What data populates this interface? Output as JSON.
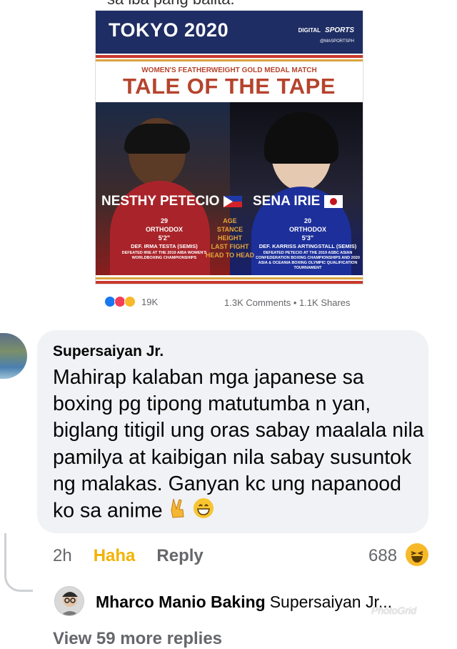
{
  "top_cut_text": "sa iba pang balita.",
  "graphic": {
    "event": "TOKYO 2020",
    "brand_small": "DIGITAL",
    "brand_sports": "SPORTS",
    "handle": "@MASPORTSPH",
    "subhead": "WOMEN'S FEATHERWEIGHT GOLD MEDAL MATCH",
    "headline": "TALE OF THE TAPE",
    "left": {
      "name": "NESTHY PETECIO",
      "age": "29",
      "stance": "ORTHODOX",
      "height": "5'2\"",
      "last_fight": "DEF. IRMA TESTA (SEMIS)",
      "h2h": "DEFEATED IRIE AT THE 2019 AIBA WOMEN'S WORLDBOXING CHAMPIONSHIPS"
    },
    "labels": {
      "age": "AGE",
      "stance": "STANCE",
      "height": "HEIGHT",
      "last_fight": "LAST FIGHT",
      "h2h": "HEAD TO HEAD"
    },
    "right": {
      "name": "SENA IRIE",
      "age": "20",
      "stance": "ORTHODOX",
      "height": "5'3\"",
      "last_fight": "DEF. KARRISS ARTINGSTALL (SEMIS)",
      "h2h": "DEFEATED PETECIO AT THE 2019 ASBC ASIAN CONFEDERATION BOXING CHAMPIONSHIPS AND 2020 ASIA & OCEANIA BOXING OLYMPIC QUALIFICATION TOURNAMENT"
    }
  },
  "post_stats": {
    "reactions": "19K",
    "comments_shares": "1.3K Comments • 1.1K Shares"
  },
  "comment": {
    "author": "Supersaiyan Jr.",
    "text": "Mahirap kalaban mga japanese sa boxing pg tipong matutumba n yan, biglang titigil ung oras sabay maalala nila pamilya at kaibigan nila sabay susuntok ng malakas. Ganyan kc ung napanood ko sa animе",
    "time": "2h",
    "haha_label": "Haha",
    "reply_label": "Reply",
    "reaction_count": "688"
  },
  "reply": {
    "author": "Mharco Manio Baking",
    "preview": "Supersaiyan Jr..."
  },
  "view_more": "View 59 more replies",
  "watermark": "PhotoGrid",
  "colors": {
    "navy": "#1e2d63",
    "accent": "#b5442d",
    "gold": "#e6a43a",
    "haha": "#f2b300"
  }
}
